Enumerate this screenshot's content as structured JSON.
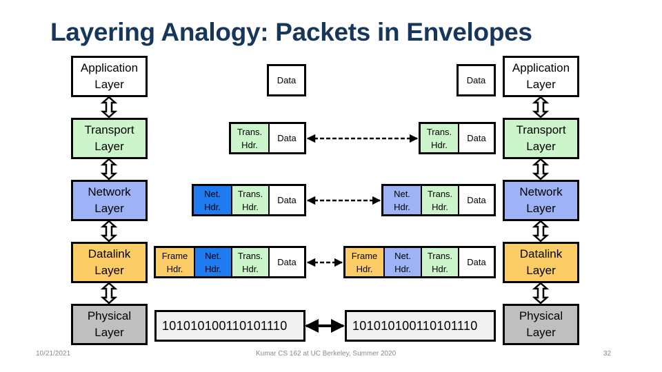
{
  "slide": {
    "title": "Layering Analogy: Packets in Envelopes",
    "footer_date": "10/21/2021",
    "footer_center": "Kumar CS 162 at UC Berkeley, Summer 2020",
    "page_number": "32"
  },
  "colors": {
    "title": "#16365c",
    "application": "#ffffff",
    "transport": "#ccf5cc",
    "network_left_layer": "#9db3f5",
    "network_hdr_left": "#1e7bf0",
    "network_hdr_right": "#9db3f5",
    "datalink": "#fccc66",
    "physical": "#bfbfbf",
    "bits_bg": "#f0f0f0"
  },
  "layers": [
    {
      "id": "application",
      "label": "Application Layer"
    },
    {
      "id": "transport",
      "label": "Transport Layer"
    },
    {
      "id": "network",
      "label": "Network Layer"
    },
    {
      "id": "datalink",
      "label": "Datalink Layer"
    },
    {
      "id": "physical",
      "label": "Physical Layer"
    }
  ],
  "segments": {
    "data": "Data",
    "trans_hdr": "Trans. Hdr.",
    "net_hdr": "Net. Hdr.",
    "frame_hdr": "Frame Hdr."
  },
  "bits": "10101010 0110101110",
  "bits_display": "1010101001101011 10",
  "bitstring": "101010100110101110",
  "arrows": {
    "transport": "dashed-double-arrow",
    "network": "dashed-double-arrow",
    "datalink": "dashed-double-arrow",
    "physical": "solid-double-arrow"
  }
}
